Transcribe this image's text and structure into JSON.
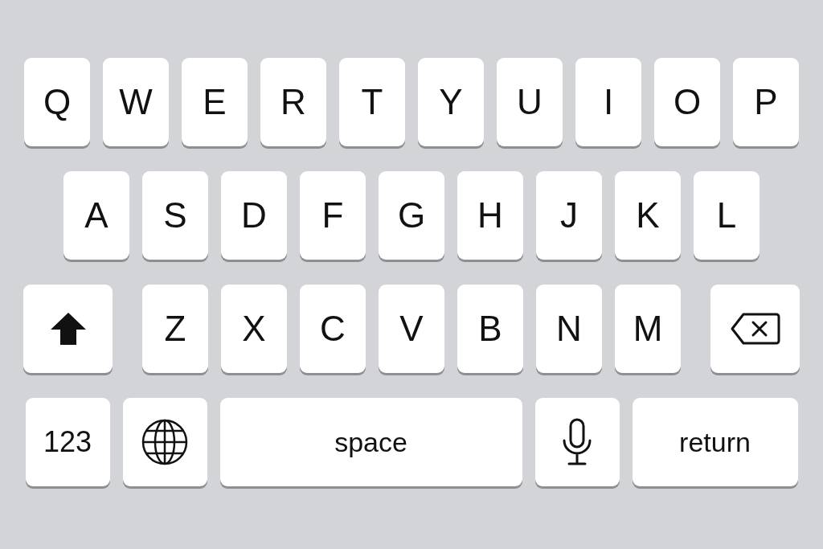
{
  "keyboard": {
    "rows": [
      {
        "keys": [
          {
            "kind": "letter",
            "label": "Q"
          },
          {
            "kind": "letter",
            "label": "W"
          },
          {
            "kind": "letter",
            "label": "E"
          },
          {
            "kind": "letter",
            "label": "R"
          },
          {
            "kind": "letter",
            "label": "T"
          },
          {
            "kind": "letter",
            "label": "Y"
          },
          {
            "kind": "letter",
            "label": "U"
          },
          {
            "kind": "letter",
            "label": "I"
          },
          {
            "kind": "letter",
            "label": "O"
          },
          {
            "kind": "letter",
            "label": "P"
          }
        ]
      },
      {
        "keys": [
          {
            "kind": "letter",
            "label": "A"
          },
          {
            "kind": "letter",
            "label": "S"
          },
          {
            "kind": "letter",
            "label": "D"
          },
          {
            "kind": "letter",
            "label": "F"
          },
          {
            "kind": "letter",
            "label": "G"
          },
          {
            "kind": "letter",
            "label": "H"
          },
          {
            "kind": "letter",
            "label": "J"
          },
          {
            "kind": "letter",
            "label": "K"
          },
          {
            "kind": "letter",
            "label": "L"
          }
        ]
      },
      {
        "keys": [
          {
            "kind": "shift"
          },
          {
            "kind": "letter",
            "label": "Z"
          },
          {
            "kind": "letter",
            "label": "X"
          },
          {
            "kind": "letter",
            "label": "C"
          },
          {
            "kind": "letter",
            "label": "V"
          },
          {
            "kind": "letter",
            "label": "B"
          },
          {
            "kind": "letter",
            "label": "N"
          },
          {
            "kind": "letter",
            "label": "M"
          },
          {
            "kind": "backspace"
          }
        ]
      },
      {
        "keys": [
          {
            "kind": "numbers",
            "label": "123"
          },
          {
            "kind": "globe"
          },
          {
            "kind": "space",
            "label": "space"
          },
          {
            "kind": "mic"
          },
          {
            "kind": "return",
            "label": "return"
          }
        ]
      }
    ]
  }
}
